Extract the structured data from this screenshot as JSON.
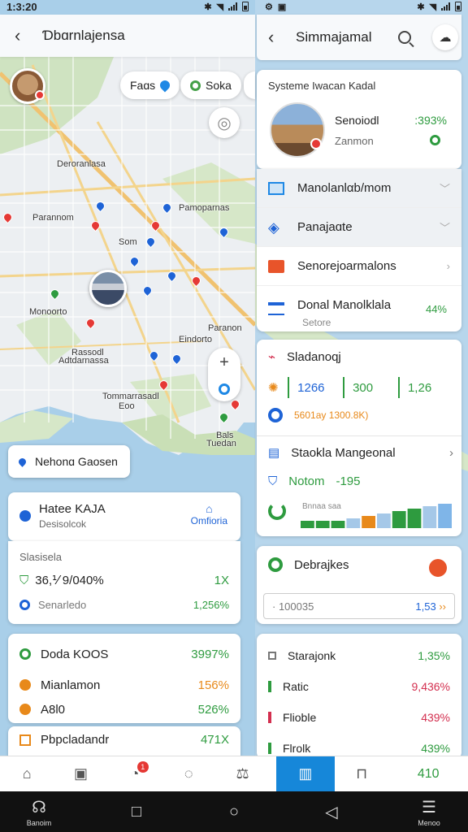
{
  "status_left": {
    "time": "1:3:20"
  },
  "left_header": {
    "title": "Ɗbɑrnlajensa"
  },
  "map": {
    "chips": [
      "Faɑs",
      "Soka"
    ],
    "labels": [
      "Deroranlasa",
      "Pamoparnas",
      "Parannom",
      "Som",
      "Monoorto",
      "Eindorto",
      "Rassodl",
      "Adtdarnassa",
      "Tommarrasadl",
      "Eoo",
      "Paranon",
      "Bals",
      "Tuedan"
    ],
    "zoom_in": "+",
    "location_pill": "Nehonɑ Gaosen"
  },
  "place_card": {
    "title": "Hatee KAJA",
    "subtitle": "Desisolcok",
    "action": "Omfioria"
  },
  "stats_card": {
    "label": "Slasisela",
    "value_main": "36,⅟ 9/040%",
    "value_right": "1X",
    "sub_label": "Senarledo",
    "sub_value": "1,256%"
  },
  "list1": [
    {
      "label": "Doda KOOS",
      "value": "3997%",
      "color": "#2e9b3f"
    },
    {
      "label": "Mianlamon",
      "value": "156%",
      "color": "#e8891a"
    },
    {
      "label": "A8l0",
      "value": "526%",
      "color": "#e8891a"
    }
  ],
  "list2": {
    "label": "Pbpcladandr",
    "value": "471X"
  },
  "status_right": {},
  "right_header": {
    "title": "Simmajamal"
  },
  "info_panel": {
    "header": "Systeme Iwacan Kadal",
    "name": "Senoiodl",
    "sub": "Zanmon",
    "value": ":393%"
  },
  "menu": [
    {
      "label": "Manolanlαb/mom",
      "type": "chevron-down"
    },
    {
      "label": "Panajaɑte",
      "type": "chevron-down"
    },
    {
      "label": "Senorejoarmalons",
      "type": "chevron-right"
    },
    {
      "label": "Donal Manolklala",
      "sub": "Setore",
      "value": "44%"
    }
  ],
  "chart_panel": {
    "title": "Sladanoqj",
    "stats": [
      "1266",
      "300",
      "1,26"
    ],
    "sub_text": "5601ay 1300.8K)",
    "section2": "Staokla Mangeonal",
    "section3_label": "Notom",
    "section3_value": "-195",
    "bars_label": "Bnnaa saa"
  },
  "chart_data": {
    "type": "bar",
    "categories": [
      "1",
      "2",
      "3",
      "4",
      "5",
      "6",
      "7",
      "8",
      "9",
      "10"
    ],
    "values": [
      3,
      3,
      3,
      4,
      5,
      6,
      7,
      8,
      9,
      10
    ],
    "colors": [
      "#2e9b3f",
      "#2e9b3f",
      "#2e9b3f",
      "#a5c8e8",
      "#e8891a",
      "#a5c8e8",
      "#2e9b3f",
      "#2e9b3f",
      "#a5c8e8",
      "#7fb5e8"
    ],
    "ylim": [
      0,
      10
    ]
  },
  "dest_panel": {
    "title": "Debrajkes",
    "input_value": "· 100035",
    "input_right": "1,53"
  },
  "price_list": [
    {
      "label": "Starajonk",
      "value": "1,35%",
      "color": "#2e9b3f"
    },
    {
      "label": "Ratic",
      "value": "9,436%",
      "color": "#d32f4f"
    },
    {
      "label": "Flioble",
      "value": "439%",
      "color": "#d32f4f"
    },
    {
      "label": "Flrolk",
      "value": "439%",
      "color": "#2e9b3f"
    }
  ],
  "tabbar": {
    "count": "410",
    "badge": "1"
  },
  "sysnav": {
    "left_caption": "Banoim",
    "right_caption": "Menoo"
  }
}
